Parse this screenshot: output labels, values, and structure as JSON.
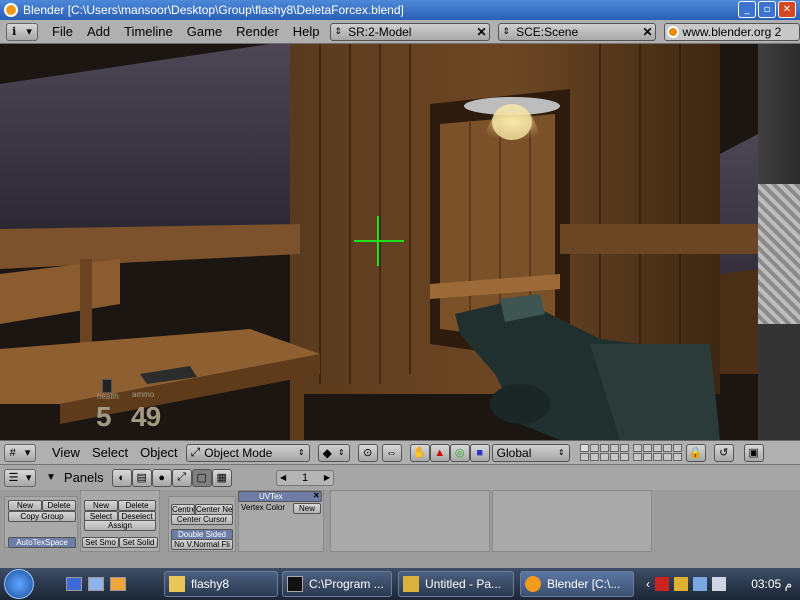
{
  "window": {
    "title": "Blender [C:\\Users\\mansoor\\Desktop\\Group\\flashy8\\DeletaForcex.blend]"
  },
  "top_header": {
    "menus": [
      "File",
      "Add",
      "Timeline",
      "Game",
      "Render",
      "Help"
    ],
    "screen_field": "SR:2-Model",
    "scene_field": "SCE:Scene",
    "url": "www.blender.org 2"
  },
  "hud": {
    "health_label": "health",
    "ammo_label": "ammo",
    "health_value": "5",
    "ammo_value": "49"
  },
  "view_header": {
    "menus": [
      "View",
      "Select",
      "Object"
    ],
    "mode": "Object Mode",
    "orientation": "Global"
  },
  "buttons_header": {
    "panels_label": "Panels",
    "page_number": "1"
  },
  "panels": {
    "link_materials": {
      "new": "New",
      "delete": "Delete",
      "copy_group": "Copy Group",
      "autotexspace": "AutoTexSpace"
    },
    "mesh_tools": {
      "new": "New",
      "delete": "Delete",
      "select": "Select",
      "deselect": "Deselect",
      "assign": "Assign",
      "set_smooth": "Set Smo",
      "set_solid": "Set Solid"
    },
    "center": {
      "centre": "Centre",
      "center_new": "Center Ne",
      "center_cursor": "Center Cursor",
      "double_sided": "Double Sided",
      "no_v_normal": "No V.Normal Fli"
    },
    "uvtex": {
      "tab": "UVTex",
      "vertex_color": "Vertex Color",
      "new": "New"
    }
  },
  "taskbar": {
    "tasks": [
      "flashy8",
      "C:\\Program ...",
      "Untitled - Pa...",
      "Blender [C:\\..."
    ],
    "clock": "03:05 م"
  }
}
